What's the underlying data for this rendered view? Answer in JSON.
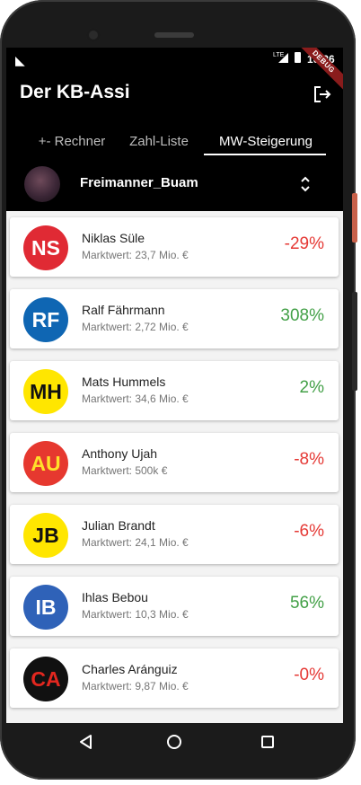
{
  "status_bar": {
    "lte": "LTE",
    "time": "10:36",
    "debug": "DEBUG"
  },
  "app": {
    "title": "Der KB-Assi"
  },
  "tabs": [
    {
      "label": "+- Rechner"
    },
    {
      "label": "Zahl-Liste"
    },
    {
      "label": "MW-Steigerung"
    }
  ],
  "team": {
    "name": "Freimanner_Buam"
  },
  "colors": {
    "positive": "#43a047",
    "negative": "#e53935"
  },
  "players": [
    {
      "initials": "NS",
      "name": "Niklas Süle",
      "value": "Marktwert: 23,7 Mio. €",
      "pct": "-29%",
      "badge_bg": "#e02a34",
      "badge_fg": "#ffffff",
      "trend": "negative"
    },
    {
      "initials": "RF",
      "name": "Ralf Fährmann",
      "value": "Marktwert: 2,72 Mio. €",
      "pct": "308%",
      "badge_bg": "#0f66b3",
      "badge_fg": "#ffffff",
      "trend": "positive"
    },
    {
      "initials": "MH",
      "name": "Mats Hummels",
      "value": "Marktwert: 34,6 Mio. €",
      "pct": "2%",
      "badge_bg": "#ffe600",
      "badge_fg": "#111111",
      "trend": "positive"
    },
    {
      "initials": "AU",
      "name": "Anthony Ujah",
      "value": "Marktwert: 500k €",
      "pct": "-8%",
      "badge_bg": "#e6382f",
      "badge_fg": "#ffe12a",
      "trend": "negative"
    },
    {
      "initials": "JB",
      "name": "Julian Brandt",
      "value": "Marktwert: 24,1 Mio. €",
      "pct": "-6%",
      "badge_bg": "#ffe600",
      "badge_fg": "#111111",
      "trend": "negative"
    },
    {
      "initials": "IB",
      "name": "Ihlas Bebou",
      "value": "Marktwert: 10,3 Mio. €",
      "pct": "56%",
      "badge_bg": "#2f62b8",
      "badge_fg": "#ffffff",
      "trend": "positive"
    },
    {
      "initials": "CA",
      "name": "Charles Aránguiz",
      "value": "Marktwert: 9,87 Mio. €",
      "pct": "-0%",
      "badge_bg": "#111111",
      "badge_fg": "#e2271f",
      "trend": "negative"
    }
  ]
}
